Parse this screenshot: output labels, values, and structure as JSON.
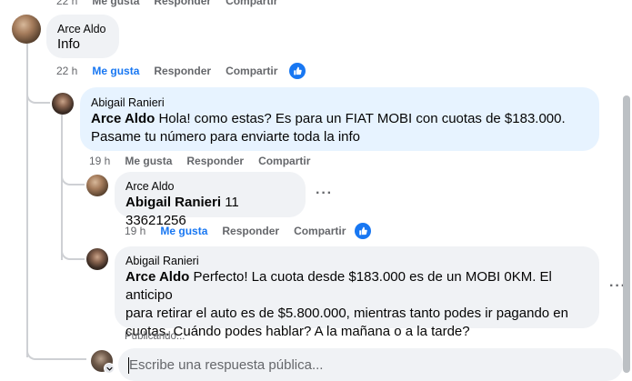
{
  "top_actions": {
    "time": "22 h",
    "like": "Me gusta",
    "reply": "Responder",
    "share": "Compartir"
  },
  "comments": [
    {
      "author": "Arce Aldo",
      "mention": "",
      "text": "Info",
      "time": "22 h",
      "like": "Me gusta",
      "reply": "Responder",
      "share": "Compartir"
    },
    {
      "author": "Abigail Ranieri",
      "mention": "Arce Aldo",
      "text_line1": "Hola! como estas? Es para un FIAT MOBI con cuotas de $183.000.",
      "text_line2": "Pasame tu número para enviarte toda la info",
      "time": "19 h",
      "like": "Me gusta",
      "reply": "Responder",
      "share": "Compartir"
    },
    {
      "author": "Arce Aldo",
      "mention": "Abigail Ranieri",
      "text": "11 33621256",
      "time": "19 h",
      "like": "Me gusta",
      "reply": "Responder",
      "share": "Compartir"
    },
    {
      "author": "Abigail Ranieri",
      "mention": "Arce Aldo",
      "text_line1": "Perfecto! La cuota desde $183.000 es de un MOBI 0KM. El anticipo",
      "text_line2": "para retirar el auto es de $5.800.000, mientras tanto podes ir pagando en",
      "text_line3": "cuotas. Cuándo podes hablar? A la mañana o a la tarde?"
    }
  ],
  "typing_indicator": "Publicando...",
  "reply_input": {
    "placeholder": "Escribe una respuesta pública..."
  },
  "colors": {
    "link_blue": "#1877f2",
    "bubble_gray": "#f0f2f5",
    "bubble_blue": "#e7f3ff",
    "meta_gray": "#65676b"
  }
}
